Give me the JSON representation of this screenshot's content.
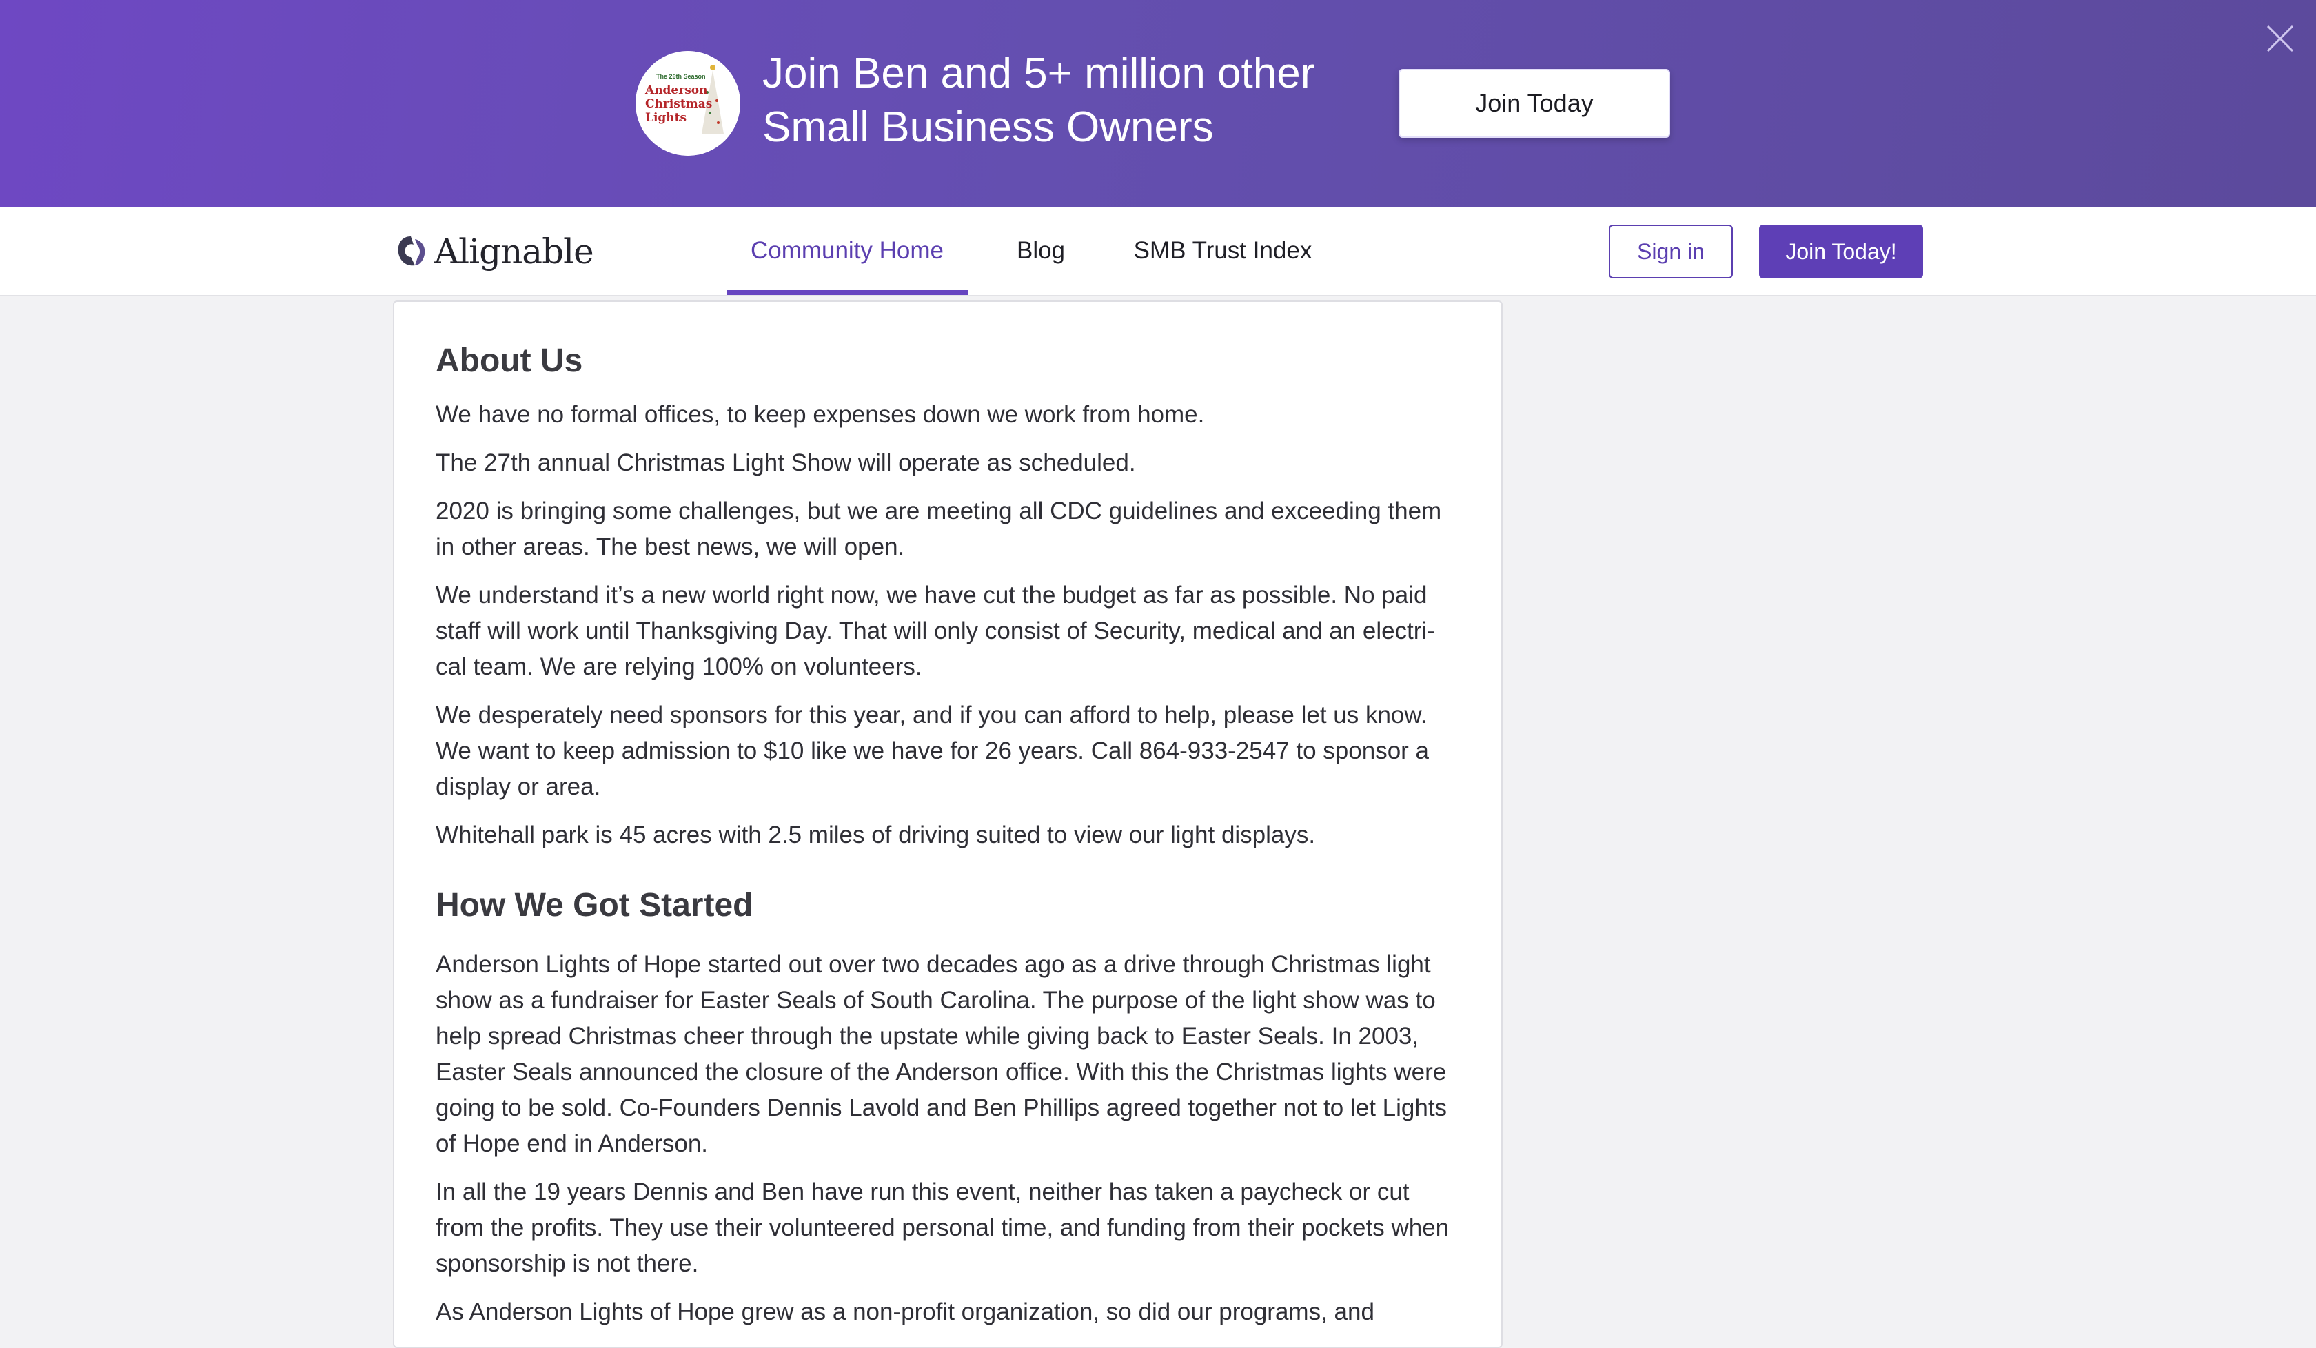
{
  "banner": {
    "logo_text": [
      "The 26th Season",
      "Anderson",
      "Christmas",
      "Lights"
    ],
    "headline_line1": "Join Ben and 5+ million other",
    "headline_line2": "Small Business Owners",
    "cta_label": "Join Today",
    "close_icon": "close-icon"
  },
  "nav": {
    "brand_name": "Alignable",
    "tabs": [
      {
        "label": "Community Home",
        "active": true
      },
      {
        "label": "Blog",
        "active": false
      },
      {
        "label": "SMB Trust Index",
        "active": false
      }
    ],
    "signin_label": "Sign in",
    "join_label": "Join Today!"
  },
  "about": {
    "title": "About Us",
    "paragraphs": [
      "We have no formal offices, to keep expenses down we work from home.",
      "The 27th annual Christmas Light Show will operate as scheduled.",
      "2020 is bringing some challenges, but we are meeting all CDC guidelines and exceeding them in other areas. The best news, we will open.",
      "We understand it’s a new world right now, we have cut the budget as far as possible. No paid staff will work until Thanksgiving Day. That will only consist of Security, medical and an electri-cal team. We are relying 100% on volunteers.",
      "We desperately need sponsors for this year, and if you can afford to help, please let us know. We want to keep admission to $10 like we have for 26 years. Call 864-933-2547 to sponsor a display or area.",
      "Whitehall park is 45 acres with 2.5 miles of driving suited to view our light displays."
    ]
  },
  "started": {
    "title": "How We Got Started",
    "paragraphs": [
      "Anderson Lights of Hope started out over two decades ago as a drive through Christmas light show as a fundraiser for Easter Seals of South Carolina. The purpose of the light show was to help spread Christmas cheer through the upstate while giving back to Easter Seals. In 2003, Easter Seals announced the closure of the Anderson office. With this the Christmas lights were going to be sold. Co-Founders Dennis Lavold and Ben Phillips agreed together not to let Lights of Hope end in Anderson.",
      "In all the 19 years Dennis and Ben have run this event, neither has taken a paycheck or cut from the profits. They use their volunteered personal time, and funding from their pockets when sponsorship is not there.",
      "As Anderson Lights of Hope grew as a non-profit organization, so did our programs, and"
    ]
  },
  "colors": {
    "banner_start": "#6e48c3",
    "banner_end": "#5c4a9c",
    "accent": "#5e3fb6"
  }
}
